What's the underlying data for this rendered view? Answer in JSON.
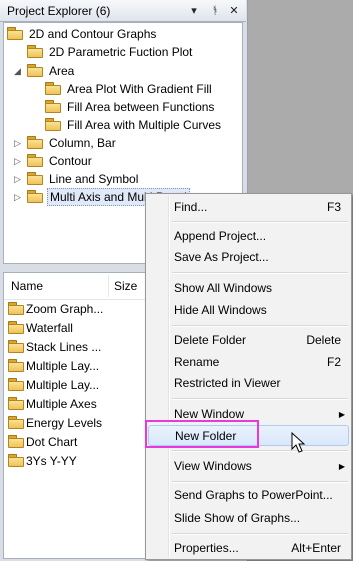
{
  "panel": {
    "title": "Project Explorer (6)",
    "buttons": [
      "▾",
      "ᚬ",
      "✕"
    ]
  },
  "tree": [
    {
      "label": "2D and Contour Graphs",
      "expander": ""
    },
    {
      "label": "2D Parametric Fuction Plot",
      "expander": ""
    },
    {
      "label": "Area",
      "expander": "◢"
    },
    {
      "label": "Area Plot With Gradient Fill",
      "expander": ""
    },
    {
      "label": "Fill Area between Functions",
      "expander": ""
    },
    {
      "label": "Fill Area with Multiple Curves",
      "expander": ""
    },
    {
      "label": "Column, Bar",
      "expander": "▷"
    },
    {
      "label": "Contour",
      "expander": "▷"
    },
    {
      "label": "Line and Symbol",
      "expander": "▷"
    },
    {
      "label": "Multi Axis and Multi Panel",
      "expander": "▷"
    }
  ],
  "list": {
    "headers": {
      "name": "Name",
      "size": "Size"
    },
    "rows": [
      "Zoom Graph...",
      "Waterfall",
      "Stack Lines ...",
      "Multiple Lay...",
      "Multiple Lay...",
      "Multiple Axes",
      "Energy Levels",
      "Dot Chart",
      "3Ys Y-YY"
    ]
  },
  "context_menu": {
    "items": [
      {
        "label": "Find...",
        "shortcut": "F3"
      },
      {
        "label": "Append Project...",
        "shortcut": ""
      },
      {
        "label": "Save As Project...",
        "shortcut": ""
      },
      {
        "label": "Show All Windows",
        "shortcut": ""
      },
      {
        "label": "Hide All Windows",
        "shortcut": ""
      },
      {
        "label": "Delete Folder",
        "shortcut": "Delete"
      },
      {
        "label": "Rename",
        "shortcut": "F2"
      },
      {
        "label": "Restricted in Viewer",
        "shortcut": ""
      },
      {
        "label": "New Window",
        "shortcut": ""
      },
      {
        "label": "New Folder",
        "shortcut": ""
      },
      {
        "label": "View Windows",
        "shortcut": ""
      },
      {
        "label": "Send Graphs to PowerPoint...",
        "shortcut": ""
      },
      {
        "label": "Slide Show of Graphs...",
        "shortcut": ""
      },
      {
        "label": "Properties...",
        "shortcut": "Alt+Enter"
      }
    ],
    "submenu_arrow": "▶",
    "highlighted": "New Folder"
  },
  "colors": {
    "highlight_box": "#e83ad8",
    "folder": "#eec35a"
  }
}
